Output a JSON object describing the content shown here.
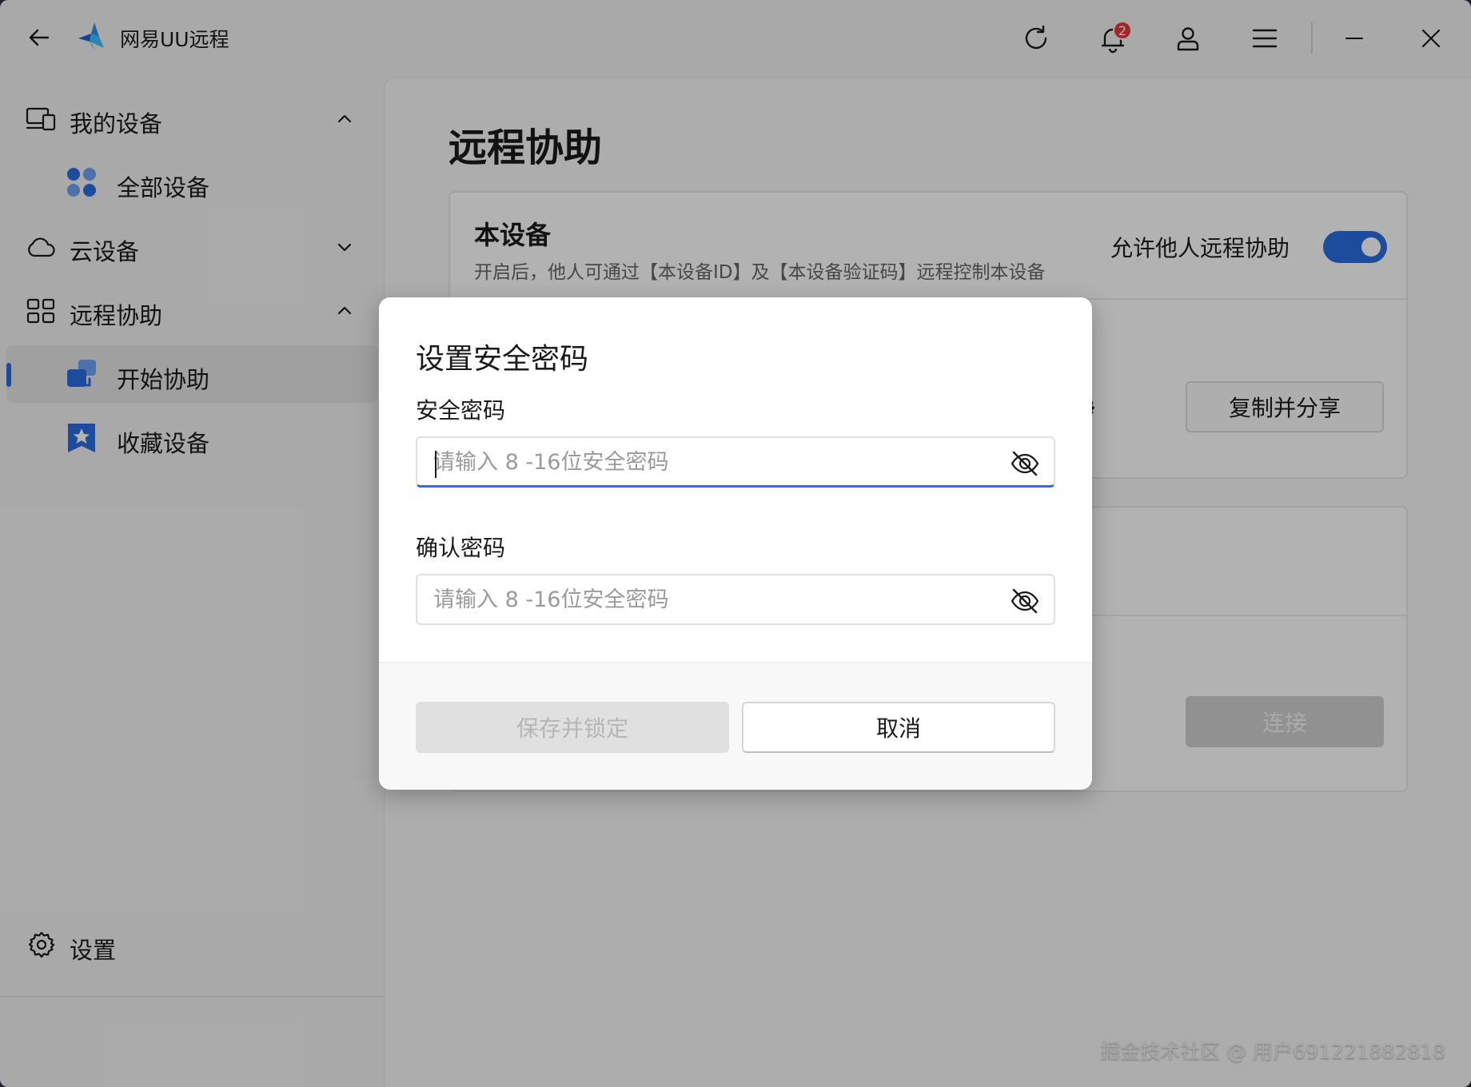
{
  "app": {
    "title": "网易UU远程",
    "notification_count": "2"
  },
  "sidebar": {
    "items": [
      {
        "label": "我的设备"
      },
      {
        "label": "全部设备"
      },
      {
        "label": "云设备"
      },
      {
        "label": "远程协助"
      },
      {
        "label": "开始协助"
      },
      {
        "label": "收藏设备"
      }
    ],
    "settings_label": "设置"
  },
  "main": {
    "page_title": "远程协助",
    "device_card": {
      "title": "本设备",
      "description": "开启后，他人可通过【本设备ID】及【本设备验证码】远程控制本设备",
      "allow_label": "允许他人远程协助",
      "toggle_on": true,
      "share_button": "复制并分享"
    },
    "connect_card": {
      "connect_button": "连接"
    }
  },
  "dialog": {
    "title": "设置安全密码",
    "password_label": "安全密码",
    "password_placeholder": "请输入 8 -16位安全密码",
    "password_value": "",
    "confirm_label": "确认密码",
    "confirm_placeholder": "请输入 8 -16位安全密码",
    "confirm_value": "",
    "save_button": "保存并锁定",
    "cancel_button": "取消"
  },
  "watermark": "掘金技术社区 @ 用户691221882818",
  "colors": {
    "accent": "#2b6de0",
    "badge": "#e23a3a"
  }
}
